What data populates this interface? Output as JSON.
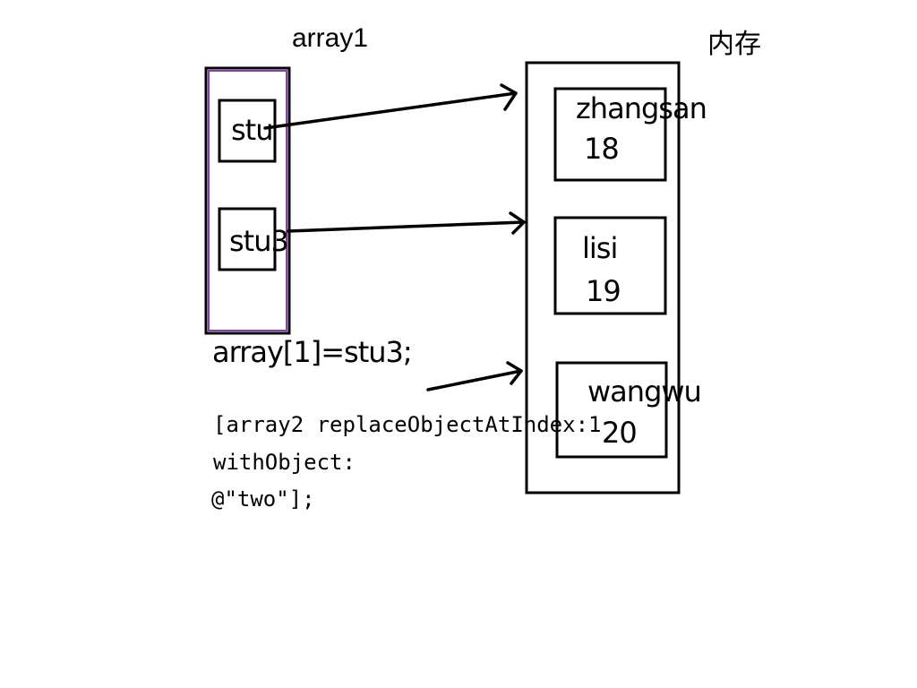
{
  "title": "array1",
  "memory_label": "内存",
  "array_cells": [
    {
      "label": "stu"
    },
    {
      "label": "stu3"
    }
  ],
  "objects": [
    {
      "name": "zhangsan",
      "age": "18"
    },
    {
      "name": "lisi",
      "age": "19"
    },
    {
      "name": "wangwu",
      "age": "20"
    }
  ],
  "assignment": "array[1]=stu3;",
  "code": {
    "line1": "[array2 replaceObjectAtIndex:1",
    "line2": " withObject:",
    "line3": "@\"two\"];"
  },
  "colors": {
    "array_outline": "#8B3FA6",
    "stroke": "#000000"
  }
}
